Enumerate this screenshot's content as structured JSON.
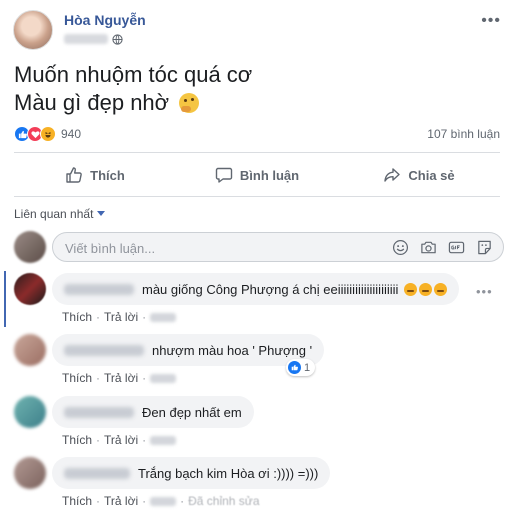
{
  "post": {
    "author": "Hòa Nguyễn",
    "more_label": "•••",
    "text_line1": "Muốn nhuộm tóc quá cơ",
    "text_line2": "Màu gì đẹp nhờ",
    "text_emoji": "thinking-face-emoji"
  },
  "stats": {
    "reactions": [
      "like",
      "love",
      "haha"
    ],
    "reaction_count": "940",
    "comment_count": "107 bình luận"
  },
  "actions": {
    "like": "Thích",
    "comment": "Bình luận",
    "share": "Chia sẻ"
  },
  "sort": {
    "label": "Liên quan nhất"
  },
  "composer": {
    "placeholder": "Viết bình luận...",
    "icons": [
      "emoji-icon",
      "camera-icon",
      "gif-icon",
      "sticker-icon"
    ]
  },
  "comments": [
    {
      "text": "màu giống Công Phượng á chị eeiiiiiiiiiiiiiiiiiiiii",
      "emojis": 3,
      "like": "Thích",
      "reply": "Trả lời",
      "sep": "·"
    },
    {
      "text": "nhượm màu hoa ' Phượng '",
      "like": "Thích",
      "reply": "Trả lời",
      "sep": "·",
      "reaction_count": "1"
    },
    {
      "text": "Đen đẹp nhất em",
      "like": "Thích",
      "reply": "Trả lời",
      "sep": "·"
    },
    {
      "text": "Trắng bạch kim Hòa ơi :)))) =)))",
      "like": "Thích",
      "reply": "Trả lời",
      "sep": "·",
      "edited": "Đã chỉnh sửa"
    }
  ],
  "colors": {
    "brand": "#385898",
    "link": "#4267b2",
    "bubble": "#f2f3f5",
    "muted": "#606770"
  }
}
